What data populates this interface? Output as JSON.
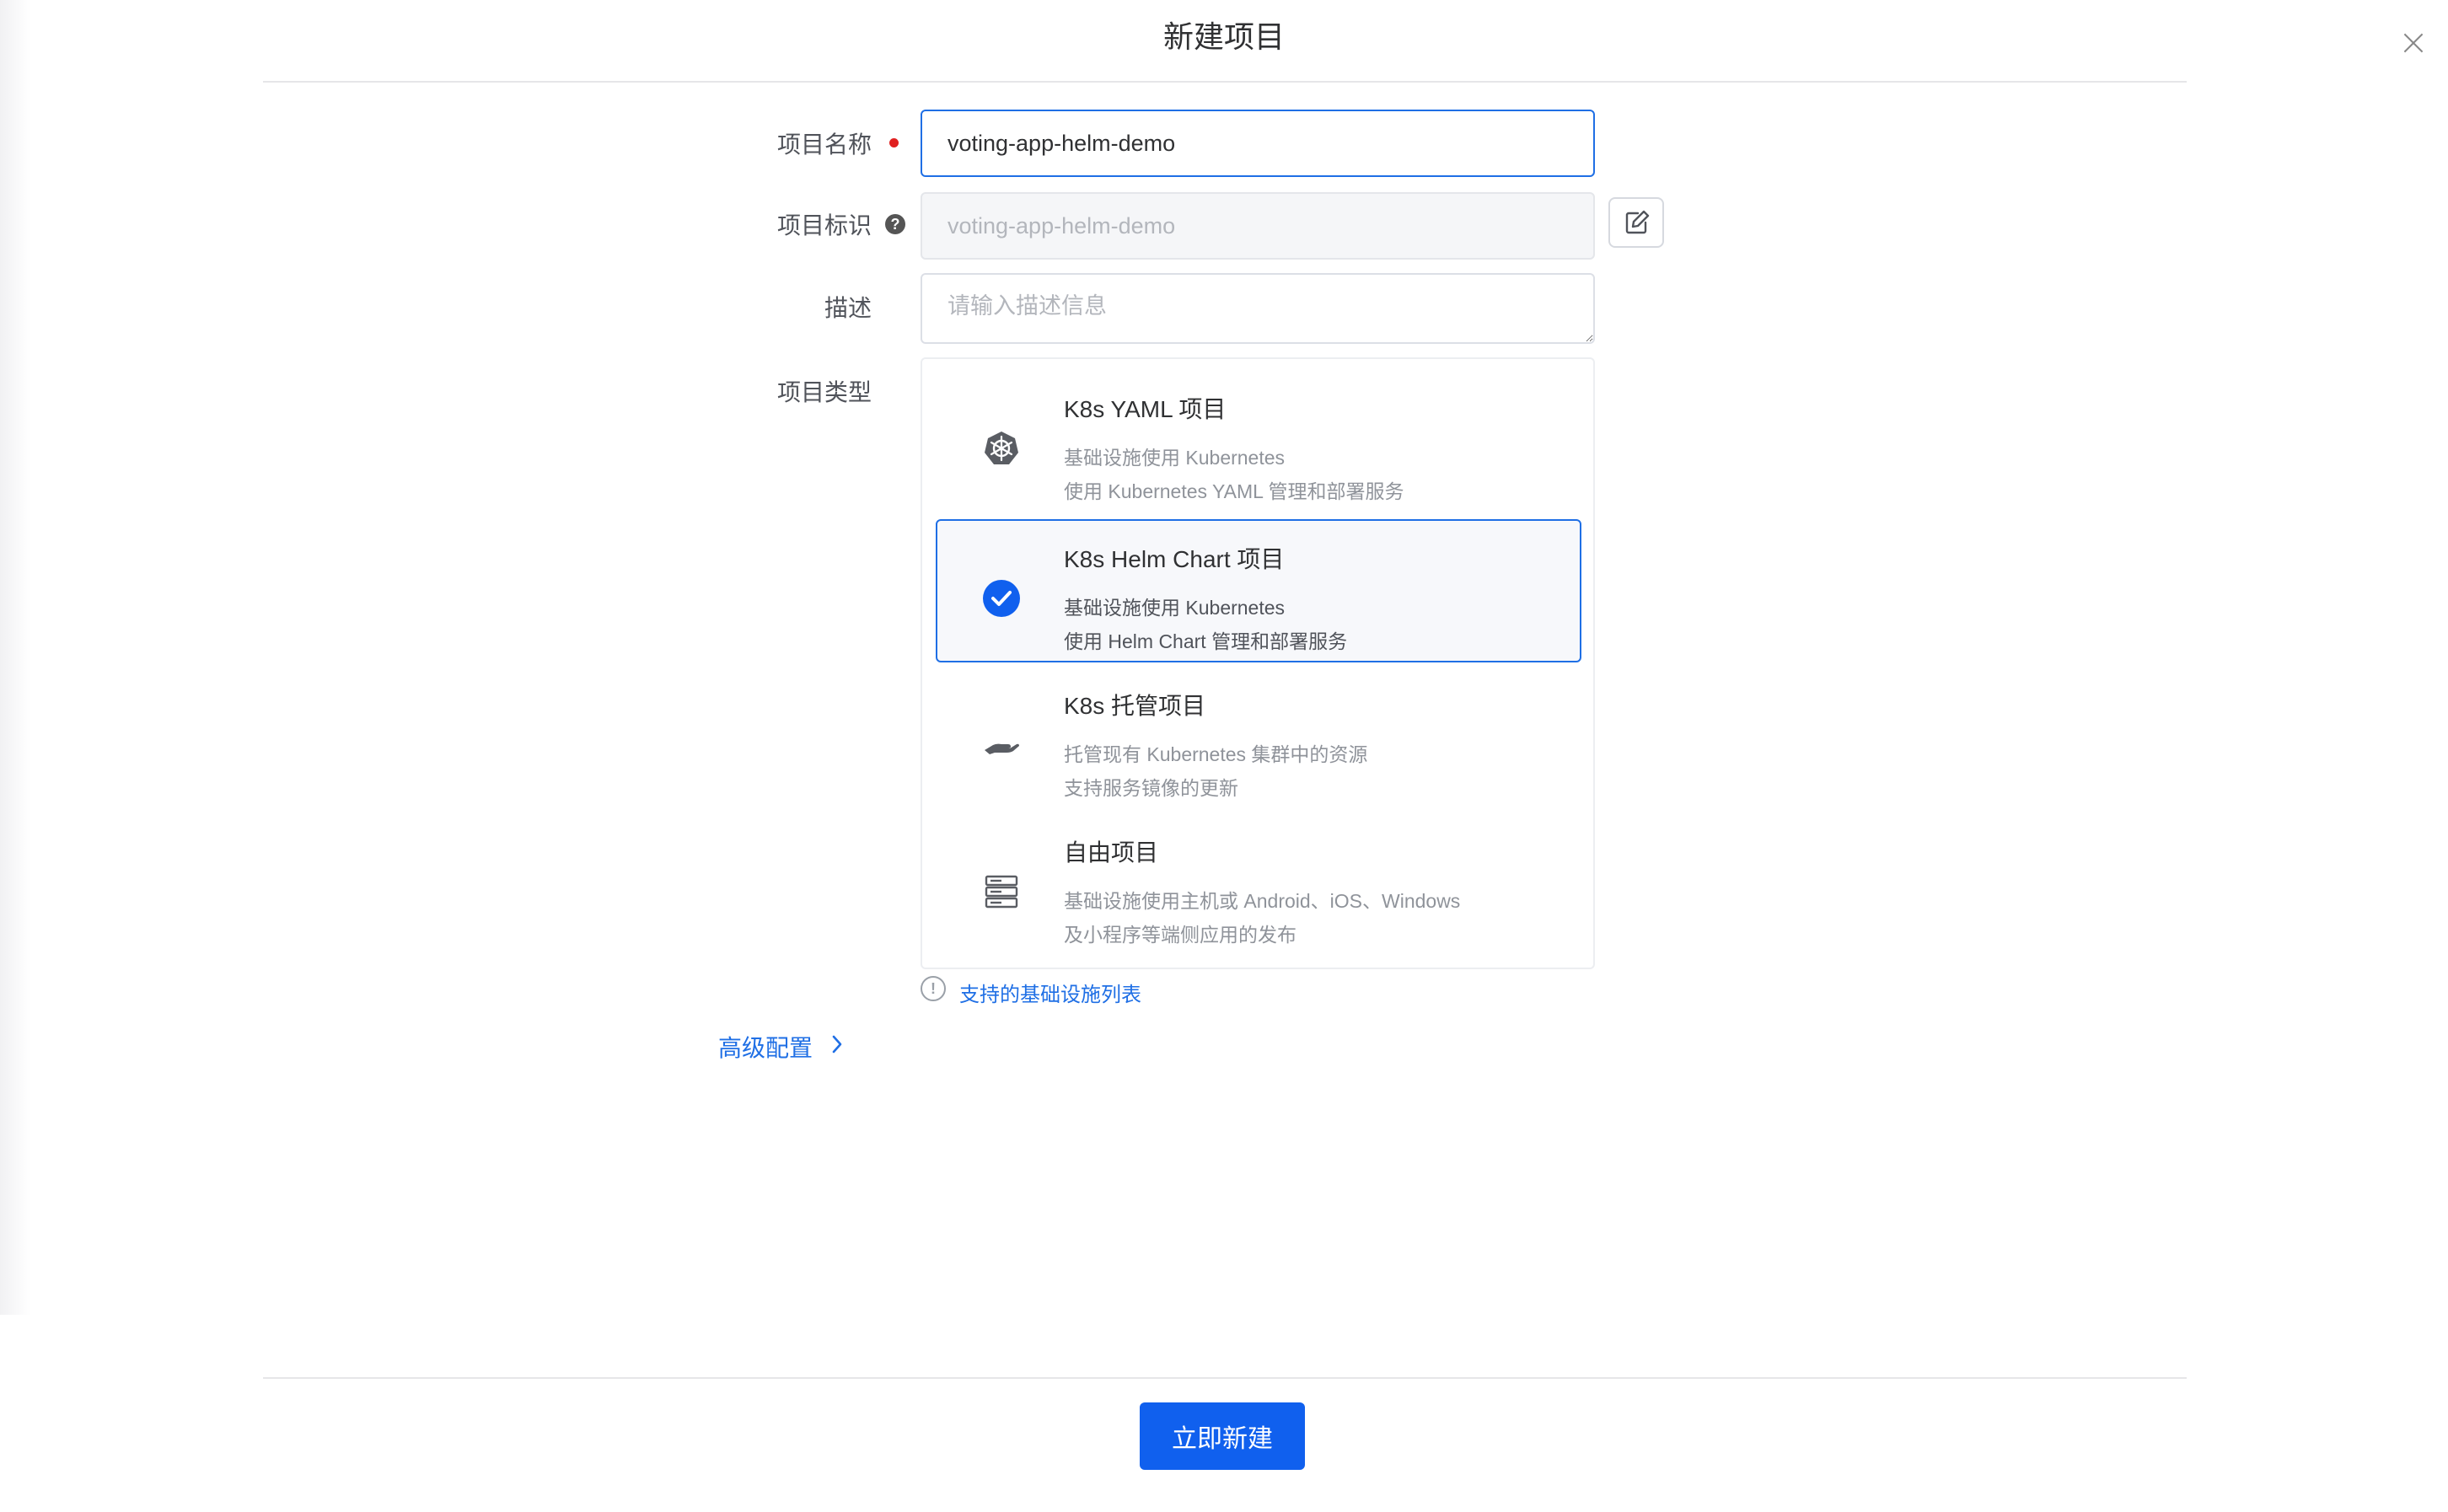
{
  "dialog": {
    "title": "新建项目",
    "close_icon": "close-icon",
    "submit_label": "立即新建"
  },
  "form": {
    "name": {
      "label": "项目名称",
      "value": "voting-app-helm-demo",
      "required": true
    },
    "identifier": {
      "label": "项目标识",
      "value": "voting-app-helm-demo",
      "help_icon": "question-circle-icon",
      "edit_icon": "edit-icon"
    },
    "description": {
      "label": "描述",
      "placeholder": "请输入描述信息"
    },
    "type": {
      "label": "项目类型",
      "options": [
        {
          "title": "K8s YAML 项目",
          "line1": "基础设施使用 Kubernetes",
          "line2": "使用 Kubernetes YAML 管理和部署服务",
          "icon": "kubernetes-icon",
          "selected": false
        },
        {
          "title": "K8s Helm Chart 项目",
          "line1": "基础设施使用 Kubernetes",
          "line2": "使用 Helm Chart 管理和部署服务",
          "icon": "check-circle-icon",
          "selected": true
        },
        {
          "title": "K8s 托管项目",
          "line1": "托管现有 Kubernetes 集群中的资源",
          "line2": "支持服务镜像的更新",
          "icon": "hand-icon",
          "selected": false
        },
        {
          "title": "自由项目",
          "line1": "基础设施使用主机或 Android、iOS、Windows",
          "line2": "及小程序等端侧应用的发布",
          "icon": "server-icon",
          "selected": false
        }
      ],
      "info_icon": "info-circle-icon",
      "info_link": "支持的基础设施列表"
    },
    "advanced": {
      "label": "高级配置",
      "icon": "chevron-right-icon"
    }
  },
  "colors": {
    "primary": "#1f6fe5",
    "required": "#e02020",
    "button": "#1060ee"
  }
}
